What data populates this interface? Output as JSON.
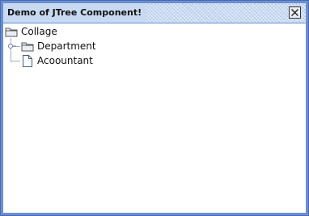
{
  "window": {
    "title": "Demo of JTree Component!"
  },
  "tree": {
    "root": {
      "label": "Collage",
      "icon": "folder-icon"
    },
    "children": [
      {
        "label": "Department",
        "icon": "folder-icon",
        "expand_handle": "collapsed-handle-icon"
      },
      {
        "label": "Acoountant",
        "icon": "file-icon"
      }
    ]
  }
}
